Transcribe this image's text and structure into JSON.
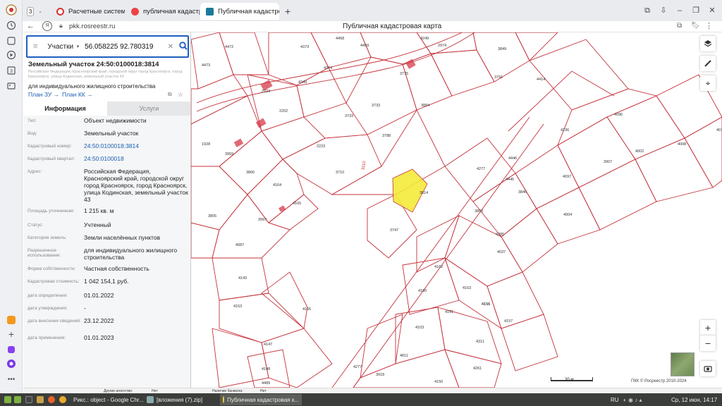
{
  "browser": {
    "tab_count": "3",
    "tabs": [
      {
        "title": "Расчетные системы",
        "favicon_color": "#d33"
      },
      {
        "title": "публичная кадастровая",
        "favicon_color": "#e44"
      },
      {
        "title": "Публичная кадастровая",
        "favicon_color": "#1b7a9a"
      }
    ],
    "url": "pkk.rosreestr.ru",
    "page_title": "Публичная кадастровая карта"
  },
  "search": {
    "category": "Участки",
    "query": "56.058225 92.780319"
  },
  "parcel": {
    "title": "Земельный участок 24:50:0100018:3814",
    "address_small": "Российская Федерация, Красноярский край, городской округ город Красноярск, город Красноярск, улица Кодинская, земельный участок 43",
    "purpose": "для индивидуального жилищного строительства",
    "plan_zu": "План ЗУ",
    "plan_kk": "План КК"
  },
  "tabs": {
    "info": "Информация",
    "services": "Услуги"
  },
  "info_rows": [
    {
      "label": "Тип:",
      "value": "Объект недвижимости"
    },
    {
      "label": "Вид:",
      "value": "Земельный участок"
    },
    {
      "label": "Кадастровый номер:",
      "value": "24:50:0100018:3814"
    },
    {
      "label": "Кадастровый квартал:",
      "value": "24:50:0100018"
    },
    {
      "label": "Адрес:",
      "value": "Российская Федерация, Красноярский край, городской округ город Красноярск, город Красноярск, улица Кодинская, земельный участок 43"
    },
    {
      "label": "Площадь уточненная:",
      "value": "1 215 кв. м"
    },
    {
      "label": "Статус:",
      "value": "Учтенный"
    },
    {
      "label": "Категория земель:",
      "value": "Земли населённых пунктов"
    },
    {
      "label": "Разрешенное использование:",
      "value": "для индивидуального жилищного строительства"
    },
    {
      "label": "Форма собственности:",
      "value": "Частная собственность"
    },
    {
      "label": "Кадастровая стоимость:",
      "value": "1 042 154,1 руб."
    },
    {
      "label": "дата определения:",
      "value": "01.01.2022"
    },
    {
      "label": "дата утверждения:",
      "value": "-"
    },
    {
      "label": "дата внесения сведений:",
      "value": "23.12.2022"
    },
    {
      "label": "дата применения:",
      "value": "01.01.2023"
    }
  ],
  "map": {
    "scale": "30 м",
    "copyright": "ПКК © Росреестр 2010-2024",
    "road_label": "3110",
    "parcel_labels": [
      "4472",
      "4373",
      "4458",
      "4459",
      "4249",
      "2974",
      "3849",
      "4473",
      "4374",
      "3775",
      "3791",
      "4349",
      "2224",
      "4414",
      "2202",
      "3733",
      "3884",
      "3733",
      "3788",
      "4096",
      "1928",
      "3959",
      "2223",
      "4236",
      "4008",
      "4019",
      "4446",
      "3907",
      "3710",
      "4277",
      "4002",
      "3866",
      "4445",
      "3846",
      "4097",
      "4164",
      "4165",
      "3863",
      "3805",
      "3997",
      "3747",
      "4004",
      "4285",
      "4087",
      "4037",
      "4162",
      "4143",
      "4160",
      "4163",
      "4153",
      "4166",
      "4161",
      "4156",
      "4156",
      "4103",
      "4157",
      "4147",
      "4311",
      "4811",
      "4148",
      "4261",
      "4277",
      "3918",
      "4150",
      "4489",
      "3814"
    ],
    "colors": {
      "boundary": "#c4323b",
      "highlight": "#f4ea3a"
    }
  },
  "taskbar": {
    "items": [
      "Рикс.: object - Google Chr...",
      "[вложения (7).zip]",
      "Публичная кадастровая к..."
    ],
    "lang": "RU",
    "clock": "Ср, 12 июн, 14:17",
    "status_left_label": "Другие агентство:",
    "status_left_value": "Нет",
    "status_right_label": "Наличие банкинга:",
    "status_right_value": "Нет"
  }
}
